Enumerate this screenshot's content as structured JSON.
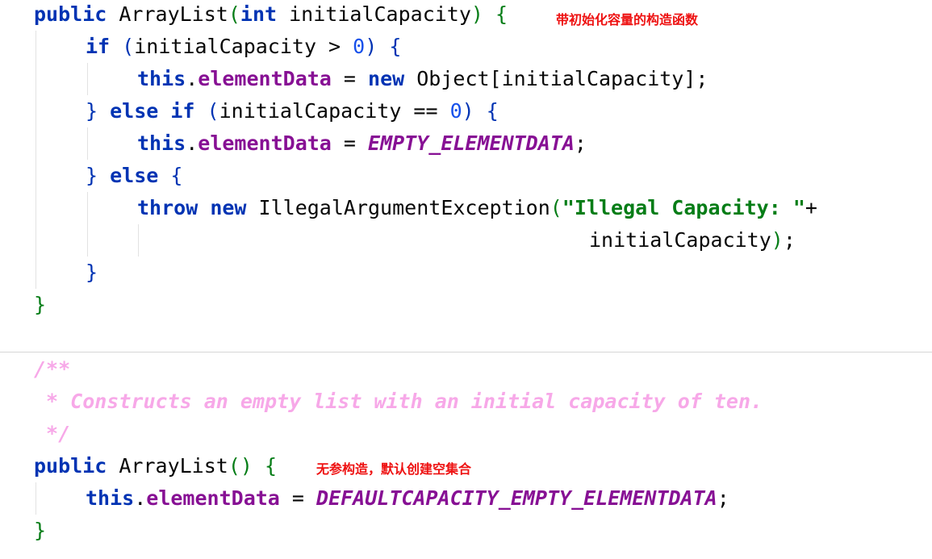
{
  "constructor1": {
    "sig_mod": "public",
    "sig_name": "ArrayList",
    "sig_open": "(",
    "sig_type": "int",
    "sig_param": "initialCapacity",
    "sig_close": ")",
    "sig_brace": "{",
    "annotation": "带初始化容量的构造函数",
    "if_kw": "if",
    "if_open": "(",
    "if_cond": "initialCapacity > ",
    "if_num": "0",
    "if_close": ")",
    "if_brace": "{",
    "l3_this": "this",
    "l3_dot": ".",
    "l3_field": "elementData",
    "l3_eq": " = ",
    "l3_new": "new",
    "l3_rest": "Object[initialCapacity];",
    "l4_rbrace": "}",
    "l4_else": "else if",
    "l4_open": "(",
    "l4_cond": "initialCapacity == ",
    "l4_num": "0",
    "l4_close": ")",
    "l4_brace": "{",
    "l5_this": "this",
    "l5_dot": ".",
    "l5_field": "elementData",
    "l5_eq": " = ",
    "l5_const": "EMPTY_ELEMENTDATA",
    "l5_semi": ";",
    "l6_rbrace": "}",
    "l6_else": "else",
    "l6_brace": "{",
    "l7_throw": "throw",
    "l7_new": "new",
    "l7_cls": "IllegalArgumentException",
    "l7_open": "(",
    "l7_str": "\"Illegal Capacity: \"",
    "l7_plus": "+",
    "l8_arg": "initialCapacity",
    "l8_close": ")",
    "l8_semi": ";",
    "l9_rbrace": "}",
    "l10_rbrace": "}"
  },
  "javadoc": {
    "open": "/**",
    "text": " * Constructs an empty list with an initial capacity of ten.",
    "close": " */"
  },
  "constructor2": {
    "sig_mod": "public",
    "sig_name": "ArrayList",
    "sig_parens": "()",
    "sig_brace": "{",
    "annotation": "无参构造，默认创建空集合",
    "l2_this": "this",
    "l2_dot": ".",
    "l2_field": "elementData",
    "l2_eq": " = ",
    "l2_const": "DEFAULTCAPACITY_EMPTY_ELEMENTDATA",
    "l2_semi": ";",
    "l3_rbrace": "}"
  },
  "colors": {
    "keyword": "#0033b3",
    "field": "#871094",
    "number": "#1750eb",
    "string": "#067d17",
    "comment": "#f7a8e8",
    "annotation": "#ee1111"
  }
}
